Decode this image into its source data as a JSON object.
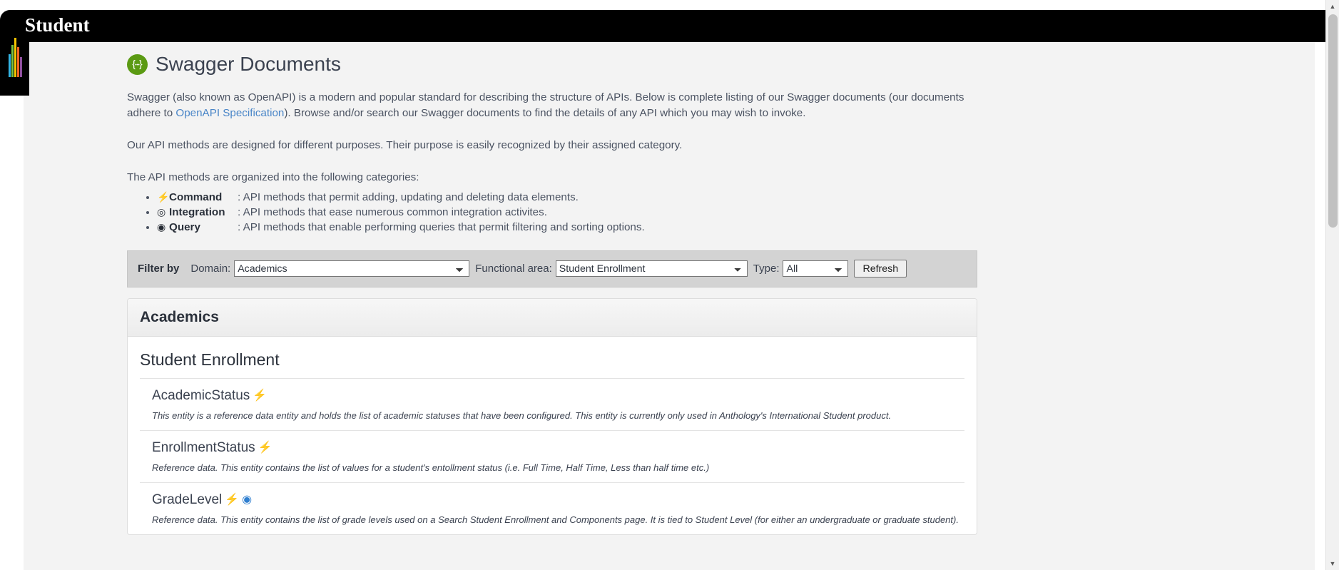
{
  "appbar": {
    "title": "Student",
    "logo_name": "anthology-logo"
  },
  "heading": {
    "icon": "swagger-icon",
    "title": "Swagger Documents"
  },
  "intro": {
    "p1_before_link": "Swagger (also known as OpenAPI) is a modern and popular standard for describing the structure of APIs. Below is complete listing of our Swagger documents (our documents adhere to ",
    "p1_link": "OpenAPI Specification",
    "p1_after_link": "). Browse and/or search our Swagger documents to find the details of any API which you may wish to invoke.",
    "p2": "Our API methods are designed for different purposes. Their purpose is easily recognized by their assigned category.",
    "p3": "The API methods are organized into the following categories:"
  },
  "categories": [
    {
      "icon": "lightning-bolt-icon",
      "glyph": "⚡",
      "name": "Command",
      "desc": ": API methods that permit adding, updating and deleting data elements."
    },
    {
      "icon": "target-circle-icon",
      "glyph": "◎",
      "name": "Integration",
      "desc": ": API methods that ease numerous common integration activites."
    },
    {
      "icon": "eye-icon",
      "glyph": "◉",
      "name": "Query",
      "desc": ": API methods that enable performing queries that permit filtering and sorting options."
    }
  ],
  "filter": {
    "label": "Filter by",
    "domain_label": "Domain:",
    "domain_value": "Academics",
    "domain_options": [
      "Academics"
    ],
    "area_label": "Functional area:",
    "area_value": "Student Enrollment",
    "area_options": [
      "Student Enrollment"
    ],
    "type_label": "Type:",
    "type_value": "All",
    "type_options": [
      "All"
    ],
    "refresh_label": "Refresh"
  },
  "results": {
    "panel_title": "Academics",
    "group_title": "Student Enrollment",
    "entities": [
      {
        "name": "AcademicStatus",
        "badges": [
          "⚡"
        ],
        "badge_names": [
          "command-badge-icon"
        ],
        "desc": "This entity is a reference data entity and holds the list of academic statuses that have been configured. This entity is currently only used in Anthology's International Student product."
      },
      {
        "name": "EnrollmentStatus",
        "badges": [
          "⚡"
        ],
        "badge_names": [
          "command-badge-icon"
        ],
        "desc": "Reference data. This entity contains the list of values for a student's entollment status (i.e. Full Time, Half Time, Less than half time etc.)"
      },
      {
        "name": "GradeLevel",
        "badges": [
          "⚡",
          "◉"
        ],
        "badge_names": [
          "command-badge-icon",
          "query-badge-icon"
        ],
        "desc": "Reference data. This entity contains the list of grade levels used on a Search Student Enrollment and Components page. It is tied to Student Level (for either an undergraduate or graduate student)."
      }
    ]
  },
  "colors": {
    "appbar_bg": "#000000",
    "content_bg": "#f3f3f3",
    "link": "#4a86c8",
    "swagger_green": "#5b9a13",
    "badge_blue": "#2f7fd0",
    "filter_bg": "#d3d3d3"
  }
}
